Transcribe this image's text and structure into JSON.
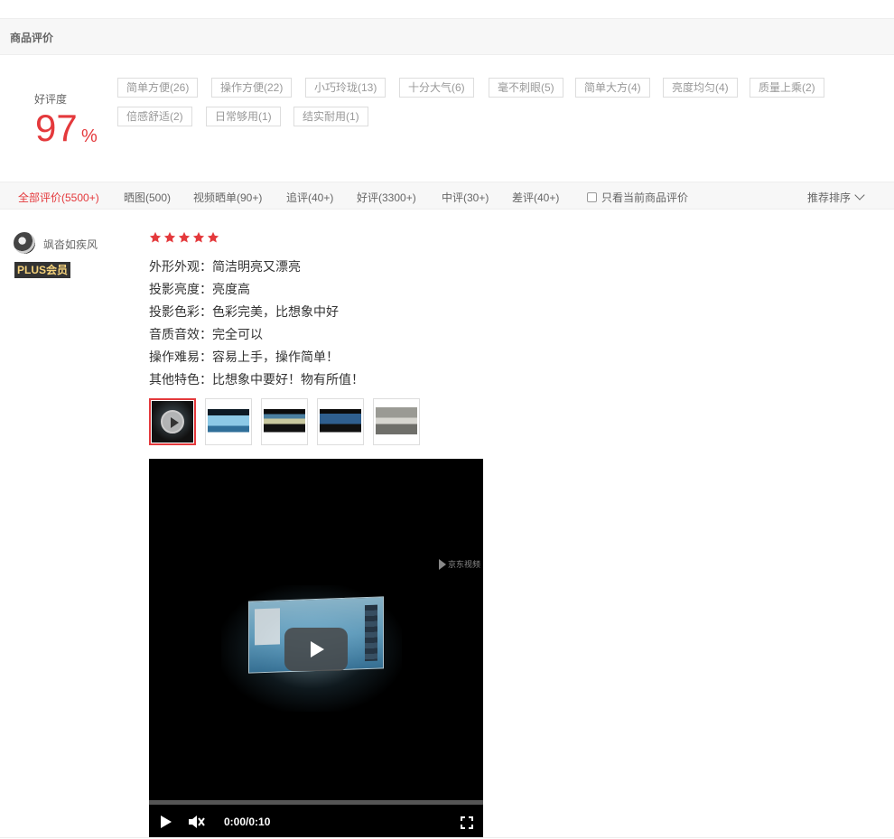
{
  "section": {
    "title": "商品评价"
  },
  "rating": {
    "label": "好评度",
    "value": "97",
    "unit": "%"
  },
  "tags": [
    "简单方便(26)",
    "操作方便(22)",
    "小巧玲珑(13)",
    "十分大气(6)",
    "毫不刺眼(5)",
    "简单大方(4)",
    "亮度均匀(4)",
    "质量上乘(2)",
    "倍感舒适(2)",
    "日常够用(1)",
    "结实耐用(1)"
  ],
  "filters": [
    "全部评价(5500+)",
    "晒图(500)",
    "视频晒单(90+)",
    "追评(40+)",
    "好评(3300+)",
    "中评(30+)",
    "差评(40+)"
  ],
  "filter_check_label": "只看当前商品评价",
  "sort_label": "推荐排序",
  "review": {
    "username": "飒沓如疾风",
    "badge": "PLUS会员",
    "stars": 5,
    "attributes": [
      "外形外观：简洁明亮又漂亮",
      "投影亮度：亮度高",
      "投影色彩：色彩完美，比想象中好",
      "音质音效：完全可以",
      "操作难易：容易上手，操作简单！",
      "其他特色：比想象中要好！物有所值！"
    ],
    "video": {
      "time": "0:00/0:10",
      "watermark": "京东视频"
    }
  },
  "colors": {
    "accent": "#e4393c",
    "badge_text": "#f5d27b"
  }
}
